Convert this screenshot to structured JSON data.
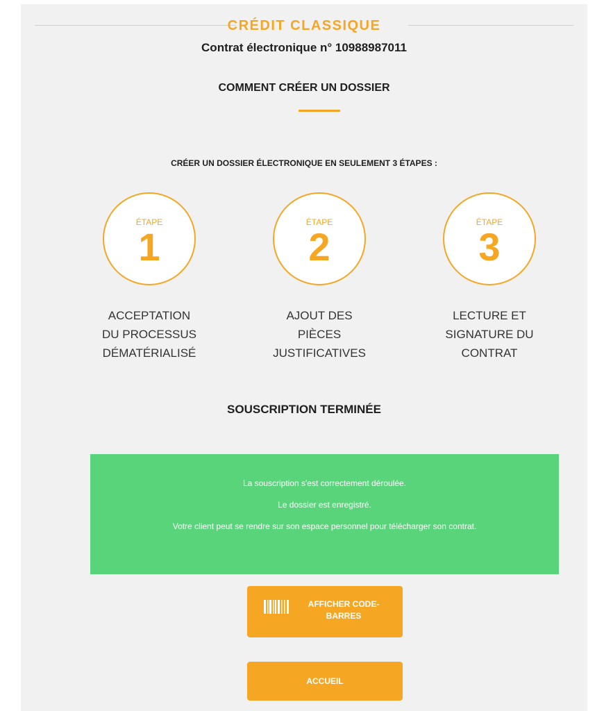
{
  "header": {
    "brand_title": "CRÉDIT CLASSIQUE",
    "contract_number": "Contrat électronique n° 10988987011"
  },
  "howto": {
    "section_title": "COMMENT CRÉER UN DOSSIER",
    "intro": "CRÉER UN DOSSIER ÉLECTRONIQUE EN SEULEMENT 3 ÉTAPES :"
  },
  "steps": [
    {
      "label": "ÉTAPE",
      "number": "1",
      "description_lines": [
        "ACCEPTATION",
        "DU PROCESSUS",
        "DÉMATÉRIALISÉ"
      ]
    },
    {
      "label": "ÉTAPE",
      "number": "2",
      "description_lines": [
        "AJOUT DES",
        "PIÈCES",
        "JUSTIFICATIVES"
      ]
    },
    {
      "label": "ÉTAPE",
      "number": "3",
      "description_lines": [
        "LECTURE ET",
        "SIGNATURE DU",
        "CONTRAT"
      ]
    }
  ],
  "completion": {
    "title": "SOUSCRIPTION TERMINÉE",
    "messages": [
      "La souscription s'est correctement déroulée.",
      "Le dossier est enregistré.",
      "Votre client peut se rendre sur son espace personnel pour télécharger son contrat."
    ]
  },
  "actions": {
    "barcode_button_label": "AFFICHER CODE-BARRES",
    "home_button_label": "ACCUEIL"
  },
  "icons": {
    "barcode": "barcode-icon"
  },
  "colors": {
    "accent": "#f5a623",
    "success": "#5ad47a",
    "background": "#f1f1f1"
  }
}
